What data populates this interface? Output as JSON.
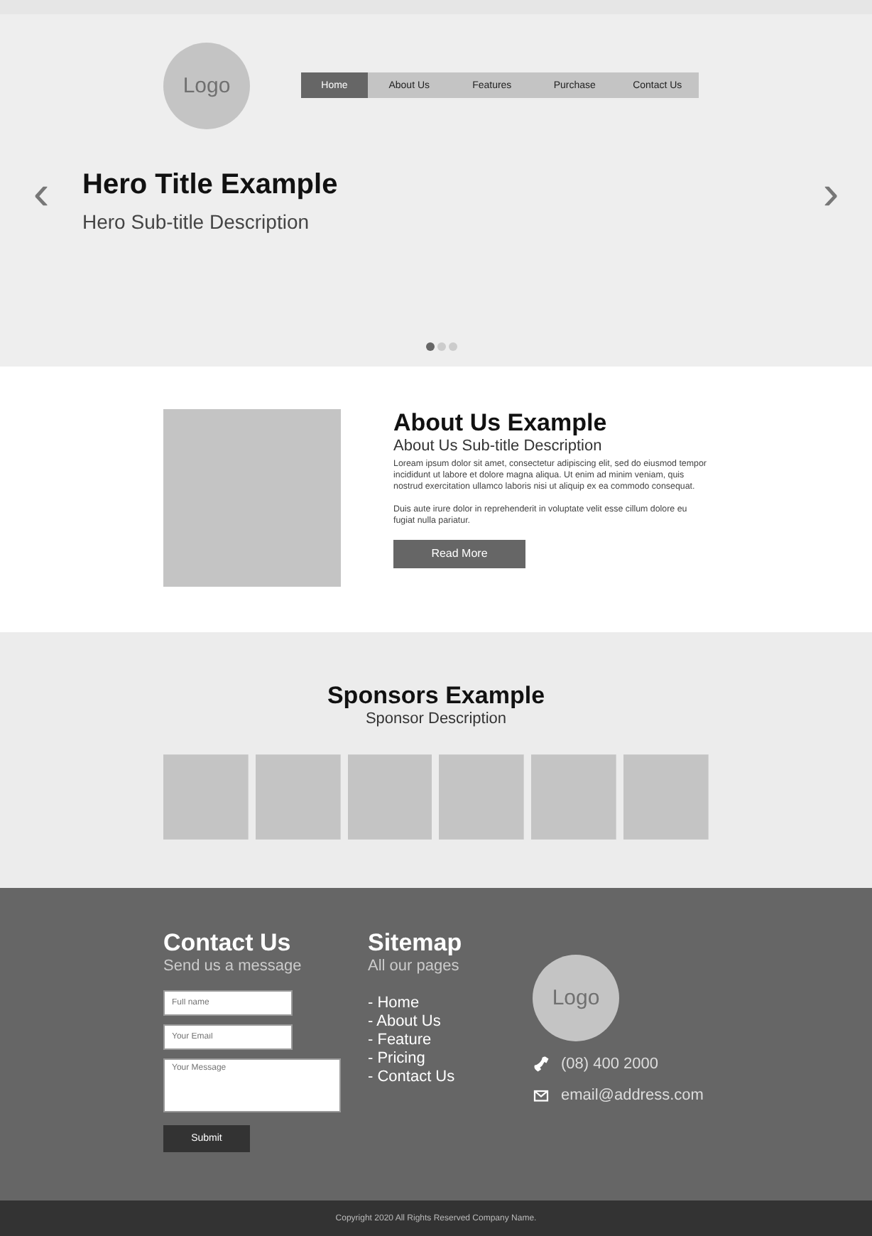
{
  "header": {
    "logo": "Logo",
    "nav": [
      {
        "label": "Home",
        "selected": true
      },
      {
        "label": "About Us",
        "selected": false
      },
      {
        "label": "Features",
        "selected": false
      },
      {
        "label": "Purchase",
        "selected": false
      },
      {
        "label": "Contact Us",
        "selected": false
      }
    ]
  },
  "hero": {
    "prev": "‹",
    "next": "›",
    "title": "Hero Title Example",
    "subtitle": "Hero Sub-title Description",
    "dots": [
      {
        "selected": true
      },
      {
        "selected": false
      },
      {
        "selected": false
      }
    ]
  },
  "about": {
    "title": "About Us Example",
    "subtitle": "About Us Sub-title Description",
    "paragraphs": [
      "Loream ipsum dolor sit amet, consectetur adipiscing elit, sed do eiusmod tempor incididunt ut labore et dolore magna aliqua. Ut enim ad minim veniam, quis nostrud exercitation ullamco laboris nisi ut aliquip ex ea commodo consequat.",
      "Duis aute irure dolor in reprehenderit in voluptate velit esse cillum dolore eu fugiat nulla pariatur."
    ],
    "button": "Read More"
  },
  "sponsors": {
    "title": "Sponsors Example",
    "subtitle": "Sponsor Description"
  },
  "footer": {
    "contact": {
      "title": "Contact Us",
      "subtitle": "Send us a message",
      "fields": [
        {
          "kind": "input",
          "placeholder": "Full name"
        },
        {
          "kind": "input",
          "placeholder": "Your Email"
        },
        {
          "kind": "textarea",
          "placeholder": "Your Message"
        }
      ],
      "button": "Submit"
    },
    "sitemap": {
      "title": "Sitemap",
      "subtitle": "All our pages",
      "links": [
        "- Home",
        "- About Us",
        "- Feature",
        "- Pricing",
        "- Contact Us"
      ]
    },
    "logo": "Logo",
    "phone": "(08) 400 2000",
    "email": "email@address.com"
  },
  "copyright": "Copyright 2020 All Rights Reserved Company Name."
}
